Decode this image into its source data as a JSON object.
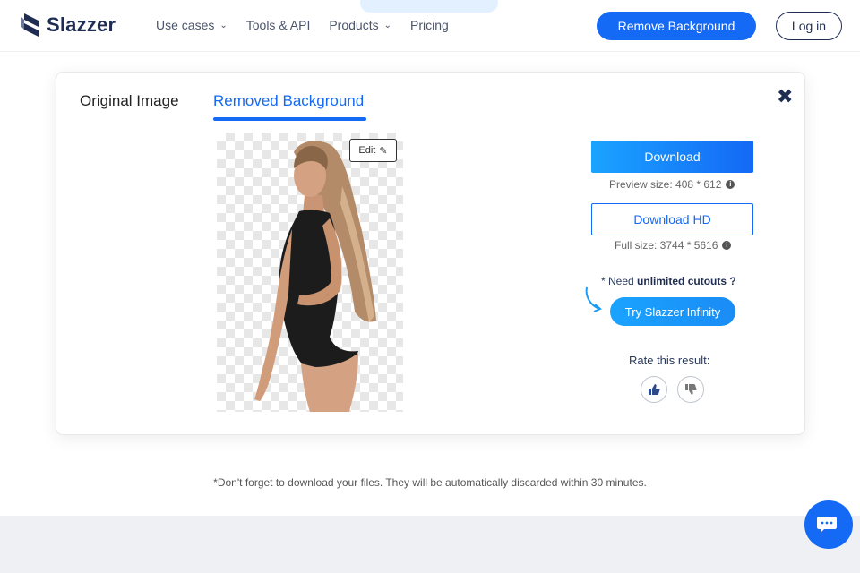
{
  "header": {
    "brand": "Slazzer",
    "nav": [
      {
        "label": "Use cases",
        "has_dropdown": true
      },
      {
        "label": "Tools & API",
        "has_dropdown": false
      },
      {
        "label": "Products",
        "has_dropdown": true
      },
      {
        "label": "Pricing",
        "has_dropdown": false
      }
    ],
    "cta_label": "Remove Background",
    "login_label": "Log in"
  },
  "modal": {
    "tabs": [
      {
        "label": "Original Image",
        "active": false
      },
      {
        "label": "Removed Background",
        "active": true
      }
    ],
    "edit_label": "Edit",
    "download_label": "Download",
    "preview_size": "Preview size: 408 * 612",
    "download_hd_label": "Download HD",
    "full_size": "Full size: 3744 * 5616",
    "need_prefix": "* Need",
    "need_bold": "unlimited cutouts ?",
    "infinity_label": "Try Slazzer Infinity",
    "rate_label": "Rate this result:"
  },
  "notice": "*Don't forget to download your files. They will be automatically discarded within 30 minutes.",
  "colors": {
    "primary": "#1469f5",
    "navy": "#1f2d52",
    "footer": "#eef0f4"
  },
  "icons": {
    "logo": "slazzer-logo-icon",
    "close": "close-icon",
    "edit": "pencil-icon",
    "info": "info-icon",
    "arrow": "curved-arrow-icon",
    "thumb_up": "thumbs-up-icon",
    "thumb_down": "thumbs-down-icon",
    "chat": "chat-icon"
  }
}
